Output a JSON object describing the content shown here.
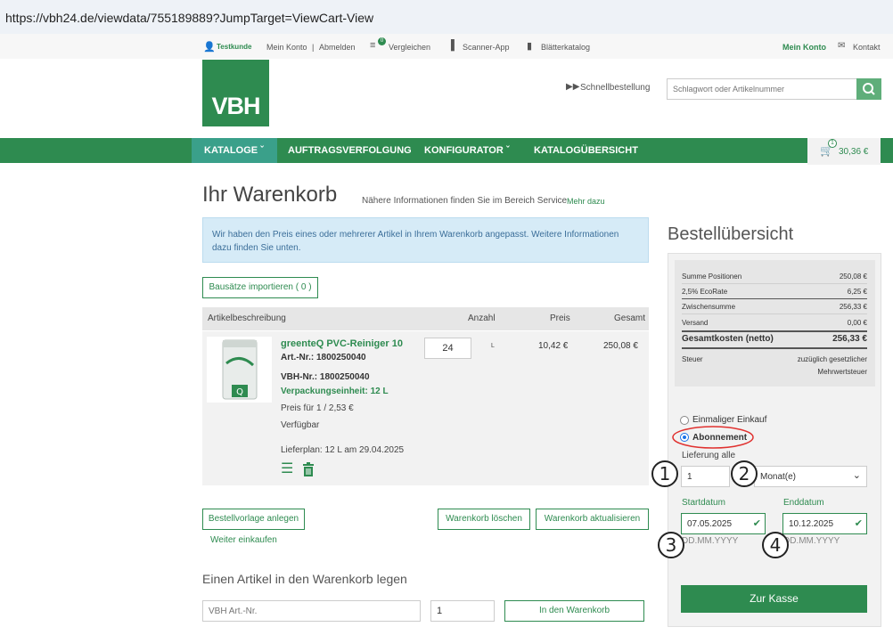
{
  "browser": {
    "url": "https://vbh24.de/viewdata/755189889?JumpTarget=ViewCart-View"
  },
  "topbar": {
    "user": "Testkunde",
    "account": "Mein Konto",
    "separator": "|",
    "logout": "Abmelden",
    "compare_badge": "0",
    "compare": "Vergleichen",
    "scanner": "Scanner-App",
    "catalog": "Blätterkatalog",
    "my_account": "Mein Konto",
    "contact": "Kontakt"
  },
  "header": {
    "logo_text": "VBH",
    "quick_order": "Schnellbestellung",
    "search_placeholder": "Schlagwort oder Artikelnummer"
  },
  "nav": {
    "items": [
      {
        "label": "KATALOGE"
      },
      {
        "label": "AUFTRAGSVERFOLGUNG"
      },
      {
        "label": "KONFIGURATOR"
      },
      {
        "label": "KATALOGÜBERSICHT"
      }
    ],
    "cart_count": "1",
    "cart_total": "30,36 €"
  },
  "page": {
    "title": "Ihr Warenkorb",
    "subtitle": "Nähere Informationen finden Sie im Bereich Service",
    "more_link": "Mehr dazu"
  },
  "notice": "Wir haben den Preis eines oder mehrerer Artikel in Ihrem Warenkorb angepasst. Weitere Informationen dazu finden Sie unten.",
  "import_button": "Bausätze importieren ( 0 )",
  "table": {
    "headers": {
      "desc": "Artikelbeschreibung",
      "qty": "Anzahl",
      "price": "Preis",
      "total": "Gesamt"
    },
    "item": {
      "name": "greenteQ PVC-Reiniger 10",
      "art_nr": "Art.-Nr.: 1800250040",
      "vbh_nr": "VBH-Nr.: 1800250040",
      "pack_unit": "Verpackungseinheit: 12 L",
      "unit_price": "Preis für 1 / 2,53 €",
      "availability": "Verfügbar",
      "delivery_plan": "Lieferplan: 12 L am 29.04.2025",
      "quantity": "24",
      "unit": "L",
      "price": "10,42 €",
      "total": "250,08 €"
    }
  },
  "buttons": {
    "create_template": "Bestellvorlage anlegen",
    "continue_shopping": "Weiter einkaufen",
    "delete_cart": "Warenkorb löschen",
    "update_cart": "Warenkorb aktualisieren"
  },
  "add_article": {
    "title": "Einen Artikel in den Warenkorb legen",
    "art_placeholder": "VBH Art.-Nr.",
    "quantity": "1",
    "button": "In den Warenkorb"
  },
  "summary": {
    "title": "Bestellübersicht",
    "rows": [
      {
        "label": "Summe Positionen",
        "value": "250,08 €"
      },
      {
        "label": "2,5% EcoRate",
        "value": "6,25 €"
      },
      {
        "label": "Zwischensumme",
        "value": "256,33 €"
      },
      {
        "label": "Versand",
        "value": "0,00 €"
      }
    ],
    "total_label": "Gesamtkosten (netto)",
    "total_value": "256,33 €",
    "tax_label": "Steuer",
    "tax_value_1": "zuzüglich gesetzlicher",
    "tax_value_2": "Mehrwertsteuer"
  },
  "order_type": {
    "one_time": "Einmaliger Einkauf",
    "subscription": "Abonnement",
    "selected": "subscription",
    "delivery_every": "Lieferung alle",
    "interval_value": "1",
    "interval_unit": "Monat(e)",
    "start_label": "Startdatum",
    "start_value": "07.05.2025",
    "start_format": "DD.MM.YYYY",
    "end_label": "Enddatum",
    "end_value": "10.12.2025",
    "end_format": "DD.MM.YYYY",
    "checkout": "Zur Kasse"
  },
  "annotations": {
    "c1": "1",
    "c2": "2",
    "c3": "3",
    "c4": "4"
  },
  "colors": {
    "brand_green": "#2e8b50",
    "notice_bg": "#d6ebf7",
    "highlight_red": "#e0312f"
  }
}
